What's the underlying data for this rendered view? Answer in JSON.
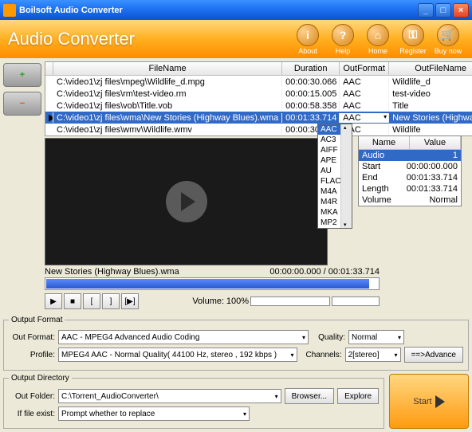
{
  "window": {
    "title": "Boilsoft Audio Converter"
  },
  "header": {
    "title": "Audio Converter",
    "buttons": [
      {
        "icon": "i",
        "label": "About"
      },
      {
        "icon": "?",
        "label": "Help"
      },
      {
        "icon": "⌂",
        "label": "Home"
      },
      {
        "icon": "⚿",
        "label": "Register"
      },
      {
        "icon": "🛒",
        "label": "Buy now"
      }
    ]
  },
  "grid": {
    "cols": {
      "filename": "FileName",
      "duration": "Duration",
      "outformat": "OutFormat",
      "outfilename": "OutFileName"
    },
    "rows": [
      {
        "fn": "C:\\video1\\zj files\\mpeg\\Wildlife_d.mpg",
        "dur": "00:00:30.066",
        "of": "AAC",
        "ofn": "Wildlife_d"
      },
      {
        "fn": "C:\\video1\\zj files\\rm\\test-video.rm",
        "dur": "00:00:15.005",
        "of": "AAC",
        "ofn": "test-video"
      },
      {
        "fn": "C:\\video1\\zj files\\vob\\Title.vob",
        "dur": "00:00:58.358",
        "of": "AAC",
        "ofn": "Title"
      },
      {
        "fn": "C:\\video1\\zj files\\wma\\New Stories (Highway Blues).wma",
        "dur": "00:01:33.714",
        "of": "AAC",
        "ofn": "New Stories (Highway Blues",
        "selected": true
      },
      {
        "fn": "C:\\video1\\zj files\\wmv\\Wildlife.wmv",
        "dur": "00:00:30.093",
        "of": "AAC",
        "ofn": "Wildlife"
      }
    ]
  },
  "formatDropdown": [
    "AAC",
    "AC3",
    "AIFF",
    "APE",
    "AU",
    "FLAC",
    "M4A",
    "M4R",
    "MKA",
    "MP2"
  ],
  "nvPanel": {
    "head": {
      "name": "Name",
      "value": "Value"
    },
    "rows": [
      {
        "n": "Audio",
        "v": "1",
        "sel": true
      },
      {
        "n": "Start",
        "v": "00:00:00.000"
      },
      {
        "n": "End",
        "v": "00:01:33.714"
      },
      {
        "n": "Length",
        "v": "00:01:33.714"
      },
      {
        "n": "Volume",
        "v": "Normal"
      }
    ]
  },
  "preview": {
    "filename": "New Stories (Highway Blues).wma",
    "time": "00:00:00.000 / 00:01:33.714"
  },
  "volume": {
    "label": "Volume:",
    "value": "100%"
  },
  "outputFormat": {
    "legend": "Output Format",
    "outformat_label": "Out Format:",
    "outformat_value": "AAC - MPEG4 Advanced Audio Coding",
    "quality_label": "Quality:",
    "quality_value": "Normal",
    "profile_label": "Profile:",
    "profile_value": "MPEG4 AAC - Normal Quality( 44100 Hz, stereo , 192 kbps )",
    "channels_label": "Channels:",
    "channels_value": "2[stereo]",
    "advance": "==>Advance"
  },
  "outputDir": {
    "legend": "Output Directory",
    "outfolder_label": "Out Folder:",
    "outfolder_value": "C:\\Torrent_AudioConverter\\",
    "browser": "Browser...",
    "explore": "Explore",
    "ifexist_label": "If file exist:",
    "ifexist_value": "Prompt whether to replace"
  },
  "start": "Start"
}
